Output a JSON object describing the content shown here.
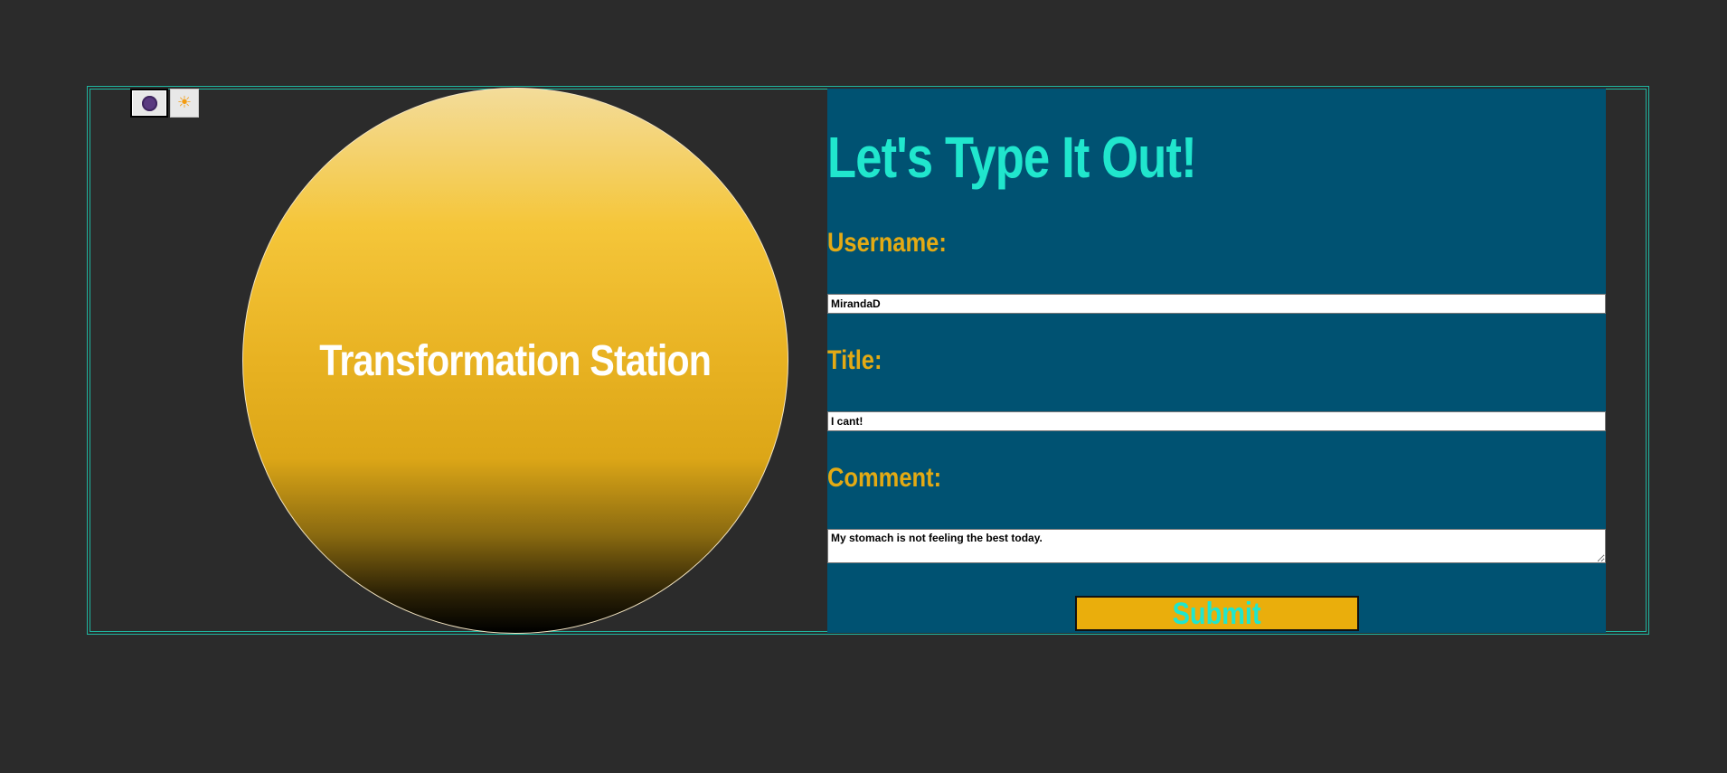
{
  "app": {
    "title": "Transformation Station"
  },
  "theme_toggle": {
    "dark_icon": "moon-icon",
    "light_icon": "sun-icon",
    "light_glyph": "☀",
    "selected": "dark"
  },
  "form": {
    "heading": "Let's Type It Out!",
    "username_label": "Username:",
    "username_value": "MirandaD",
    "title_label": "Title:",
    "title_value": "I cant!",
    "comment_label": "Comment:",
    "comment_value": "My stomach is not feeling the best today.",
    "submit_label": "Submit"
  },
  "colors": {
    "page_background": "#2b2b2b",
    "frame_border": "#1fb5a0",
    "form_panel": "#005272",
    "heading": "#20e6cd",
    "labels": "#e3aa14",
    "submit_background": "#eaae0c",
    "circle_top": "#f3dc9a",
    "circle_mid": "#f5c63a",
    "circle_bottom": "#000000"
  }
}
